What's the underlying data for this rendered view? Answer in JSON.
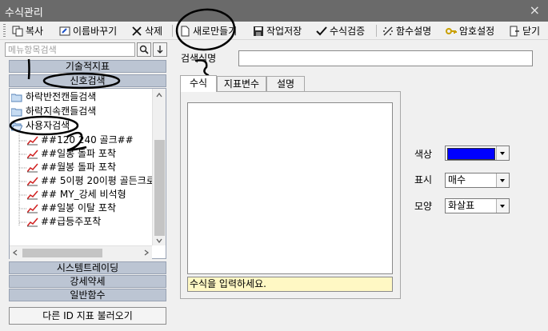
{
  "window": {
    "title": "수식관리",
    "close_glyph": "×"
  },
  "toolbar": {
    "buttons": [
      {
        "label": "복사",
        "icon": "copy-icon"
      },
      {
        "label": "이름바꾸기",
        "icon": "rename-icon"
      },
      {
        "label": "삭제",
        "icon": "delete-icon"
      },
      {
        "label": "새로만들기",
        "icon": "new-document-icon"
      },
      {
        "label": "작업저장",
        "icon": "save-icon"
      },
      {
        "label": "수식검증",
        "icon": "check-icon"
      },
      {
        "label": "함수설명",
        "icon": "function-help-icon"
      },
      {
        "label": "암호설정",
        "icon": "key-icon"
      },
      {
        "label": "닫기",
        "icon": "close-door-icon"
      }
    ]
  },
  "sidebar": {
    "search_placeholder": "메뉴항목검색",
    "categories_top": [
      "기술적지표",
      "신호검색"
    ],
    "tree": [
      {
        "label": "하락반전캔들검색",
        "type": "folder"
      },
      {
        "label": "하락지속캔들검색",
        "type": "folder"
      },
      {
        "label": "사용자검색",
        "type": "folder-open"
      },
      {
        "label": "##120 240 골크##",
        "type": "item"
      },
      {
        "label": "##일봉 돌파 포착",
        "type": "item"
      },
      {
        "label": "##월봉 돌파 포착",
        "type": "item"
      },
      {
        "label": "## 5이평 20이평 골든크로",
        "type": "item"
      },
      {
        "label": "## MY_강세 비석형",
        "type": "item"
      },
      {
        "label": "##일봉 이탈 포착",
        "type": "item"
      },
      {
        "label": "##급등주포착",
        "type": "item"
      }
    ],
    "categories_bottom": [
      "시스템트레이딩",
      "강세약세",
      "일반함수"
    ],
    "load_button": "다른 ID 지표 불러오기"
  },
  "main": {
    "name_label": "검색식명",
    "name_value": "",
    "tabs": [
      "수식",
      "지표변수",
      "설명"
    ],
    "formula_value": "",
    "hint": "수식을 입력하세요.",
    "props": {
      "color_label": "색상",
      "color_value": "#0000ff",
      "display_label": "표시",
      "display_value": "매수",
      "shape_label": "모양",
      "shape_value": "화살표"
    }
  },
  "annotations": {
    "marks": [
      "1",
      "2",
      "3"
    ]
  }
}
